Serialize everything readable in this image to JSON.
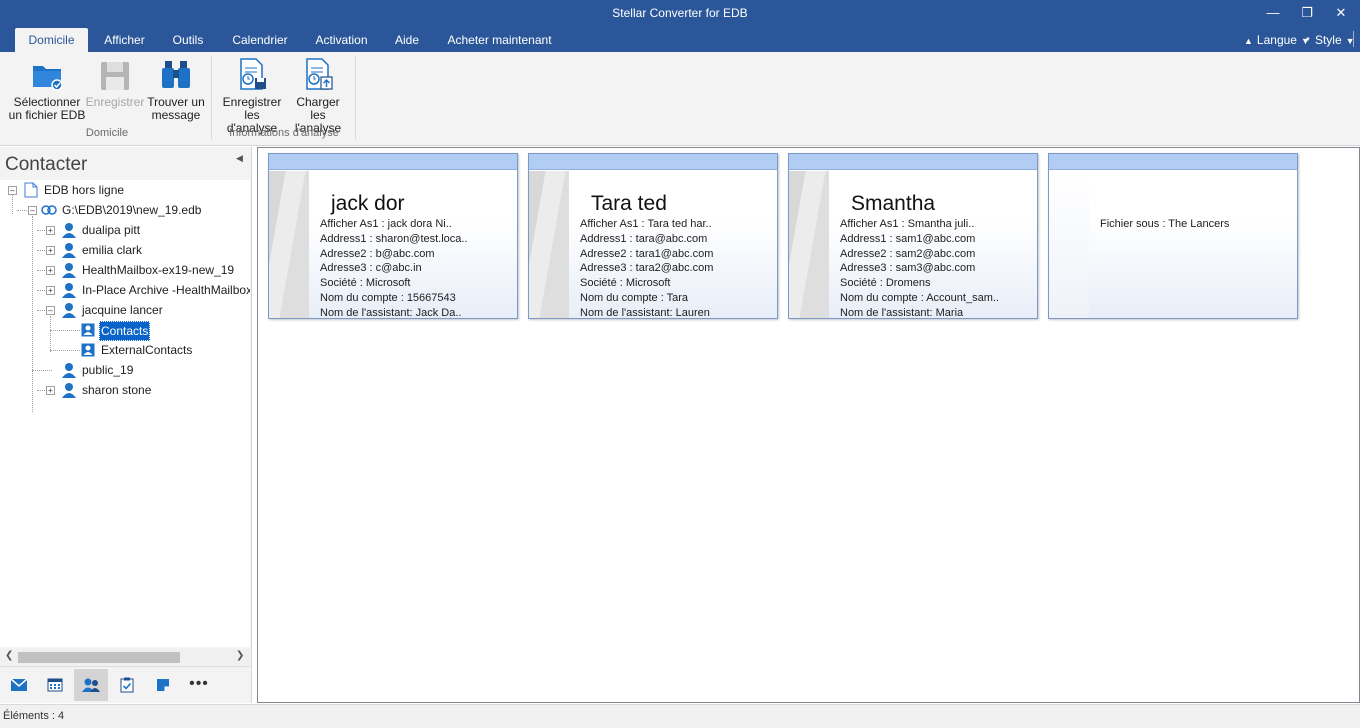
{
  "app": {
    "title": "Stellar Converter for EDB"
  },
  "tabs": [
    {
      "label": "Domicile",
      "active": true
    },
    {
      "label": "Afficher"
    },
    {
      "label": "Outils"
    },
    {
      "label": "Calendrier"
    },
    {
      "label": "Activation"
    },
    {
      "label": "Aide"
    },
    {
      "label": "Acheter maintenant"
    }
  ],
  "options": {
    "language": "Langue",
    "style": "Style"
  },
  "ribbon": {
    "select_file": [
      "Sélectionner",
      "un fichier EDB"
    ],
    "save": [
      "Enregistrer"
    ],
    "find_message": [
      "Trouver un",
      "message"
    ],
    "save_scan": [
      "Enregistrer",
      "les d'analyse"
    ],
    "load_scan": [
      "Charger les",
      "l'analyse"
    ],
    "group_home": "Domicile",
    "group_scan": "Informations d'analyse"
  },
  "left_pane": {
    "title": "Contacter",
    "tree": {
      "root": "EDB hors ligne",
      "edb": "G:\\EDB\\2019\\new_19.edb",
      "mailboxes": [
        "dualipa pitt",
        "emilia clark",
        "HealthMailbox-ex19-new_19",
        "In-Place Archive -HealthMailbox",
        "jacquine lancer"
      ],
      "folders": [
        "Contacts",
        "ExternalContacts"
      ],
      "mailboxes_after": [
        "public_19",
        "sharon stone"
      ]
    }
  },
  "cards": [
    {
      "name": "jack dor",
      "fields": [
        "Afficher As1 : jack dora Ni..",
        "Address1 : sharon@test.loca..",
        "Adresse2 : b@abc.com",
        "Adresse3 : c@abc.in",
        "Société : Microsoft",
        "Nom du compte : 15667543",
        "Nom de l'assistant: Jack Da.."
      ]
    },
    {
      "name": "Tara ted",
      "fields": [
        "Afficher As1 : Tara ted har..",
        "Address1 : tara@abc.com",
        "Adresse2 : tara1@abc.com",
        "Adresse3 : tara2@abc.com",
        "Société : Microsoft",
        "Nom du compte : Tara",
        "Nom de l'assistant: Lauren"
      ]
    },
    {
      "name": "Smantha",
      "fields": [
        "Afficher As1 : Smantha juli..",
        "Address1 : sam1@abc.com",
        "Adresse2 : sam2@abc.com",
        "Adresse3 : sam3@abc.com",
        "Société : Dromens",
        "Nom du compte : Account_sam..",
        "Nom de l'assistant: Maria"
      ]
    },
    {
      "name": "",
      "fields": [
        "Fichier sous : The Lancers"
      ]
    }
  ],
  "status": {
    "items": "Éléments : 4"
  },
  "colors": {
    "titlebar": "#2b579a",
    "accent": "#1e72c6",
    "selection": "#0a63c8",
    "card_header": "#b2cdf3"
  },
  "icons": [
    "minimize-icon",
    "maximize-icon",
    "close-icon",
    "folder-icon",
    "floppy-icon",
    "binoculars-icon",
    "save-scan-icon",
    "load-scan-icon",
    "mail-icon",
    "calendar-icon",
    "contacts-icon",
    "tasks-icon",
    "notes-icon",
    "more-icon"
  ]
}
